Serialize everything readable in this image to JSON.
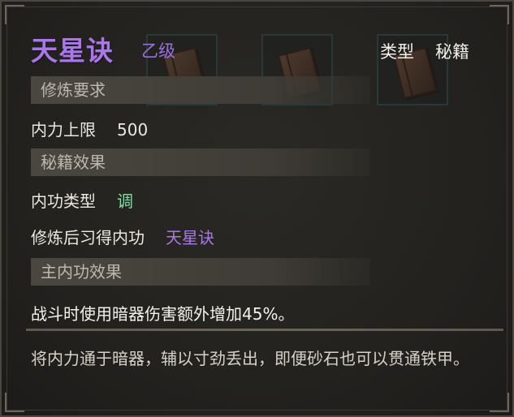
{
  "item": {
    "name": "天星诀",
    "grade": "乙级",
    "type_label": "类型",
    "type_value": "秘籍"
  },
  "sections": {
    "requirements": "修炼要求",
    "book_effects": "秘籍效果",
    "main_effects": "主内功效果"
  },
  "requirements": {
    "label": "内力上限",
    "value": "500"
  },
  "book_effects": {
    "type_label": "内功类型",
    "type_value": "调",
    "learn_label": "修炼后习得内功",
    "learn_value": "天星诀"
  },
  "main_effect_text": "战斗时使用暗器伤害额外增加45%。",
  "description": "将内力通于暗器，辅以寸劲丢出，即便砂石也可以贯通铁甲。",
  "icons": {
    "slot_icon": "book-icon"
  },
  "colors": {
    "name": "#a879e6",
    "grade": "#9a6fde",
    "inner_type": "#7ee0a0",
    "section_bg": "#4a4740"
  }
}
